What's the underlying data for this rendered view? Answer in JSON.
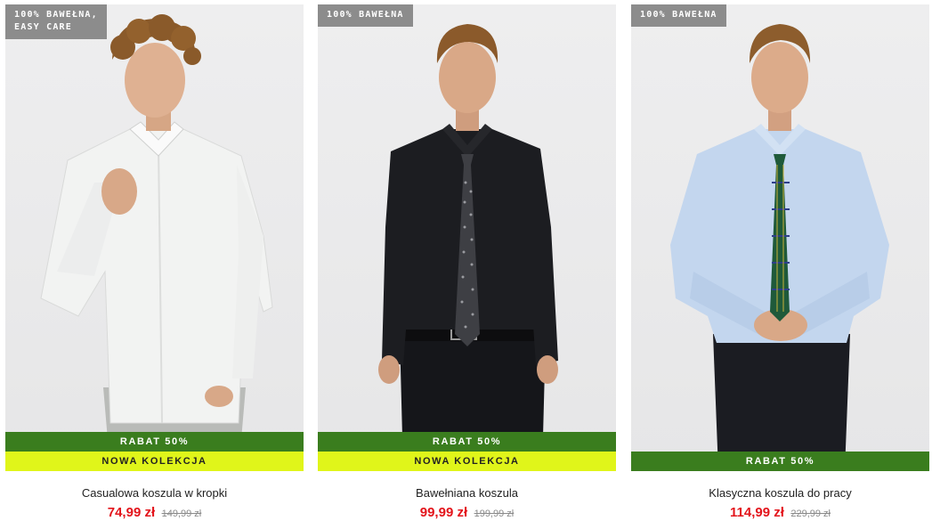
{
  "products": [
    {
      "badge": "100% BAWEŁNA,\nEASY CARE",
      "discount_label": "RABAT 50%",
      "new_label": "NOWA KOLEKCJA",
      "name": "Casualowa koszula w kropki",
      "price": "74,99 zł",
      "old_price": "149,99 zł",
      "shirt_color": "#f2f3f2",
      "pants_color": "#b7b9b6"
    },
    {
      "badge": "100% BAWEŁNA",
      "discount_label": "RABAT 50%",
      "new_label": "NOWA KOLEKCJA",
      "name": "Bawełniana koszula",
      "price": "99,99 zł",
      "old_price": "199,99 zł",
      "shirt_color": "#1c1d21",
      "pants_color": "#15161a"
    },
    {
      "badge": "100% BAWEŁNA",
      "discount_label": "RABAT 50%",
      "new_label": "",
      "name": "Klasyczna koszula do pracy",
      "price": "114,99 zł",
      "old_price": "229,99 zł",
      "shirt_color": "#c3d6ee",
      "pants_color": "#1b1c22"
    }
  ],
  "colors": {
    "discount_bg": "#3a7d1e",
    "new_bg": "#e0f51a",
    "price": "#e3141b",
    "badge_bg": "#8c8c8c"
  }
}
